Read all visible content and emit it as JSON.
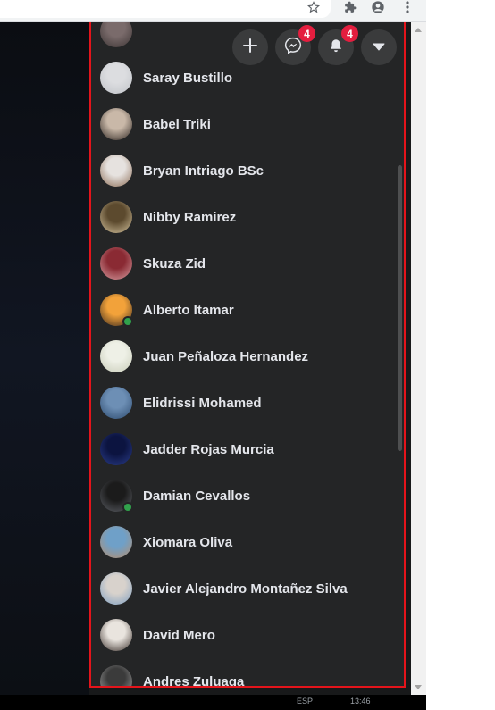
{
  "browser": {
    "icons": [
      "star-icon",
      "extensions-icon",
      "profile-icon",
      "menu-icon"
    ]
  },
  "header": {
    "buttons": [
      {
        "name": "create-button",
        "icon": "plus-icon"
      },
      {
        "name": "messenger-button",
        "icon": "messenger-icon",
        "badge": "4"
      },
      {
        "name": "notifications-button",
        "icon": "bell-icon",
        "badge": "4"
      },
      {
        "name": "account-button",
        "icon": "caret-down-icon"
      }
    ]
  },
  "contacts": [
    {
      "name": "",
      "online": false,
      "avatar_colors": [
        "#7a6b6b",
        "#3c3434"
      ]
    },
    {
      "name": "Saray Bustillo",
      "online": false,
      "avatar_colors": [
        "#dcdde0",
        "#bfc2c7"
      ]
    },
    {
      "name": "Babel Triki",
      "online": false,
      "avatar_colors": [
        "#c9b8a8",
        "#2c2420"
      ]
    },
    {
      "name": "Bryan Intriago BSc",
      "online": false,
      "avatar_colors": [
        "#e6e2df",
        "#8a6a52"
      ]
    },
    {
      "name": "Nibby Ramirez",
      "online": false,
      "avatar_colors": [
        "#5c4a2e",
        "#d6c5a0"
      ]
    },
    {
      "name": "Skuza Zid",
      "online": false,
      "avatar_colors": [
        "#8a2a33",
        "#d9a0a4"
      ]
    },
    {
      "name": "Alberto Itamar",
      "online": true,
      "avatar_colors": [
        "#f2a23a",
        "#3b2a1e"
      ]
    },
    {
      "name": "Juan Peñaloza Hernandez",
      "online": false,
      "avatar_colors": [
        "#eef0e6",
        "#c7cbb7"
      ]
    },
    {
      "name": "Elidrissi Mohamed",
      "online": false,
      "avatar_colors": [
        "#6d8fb5",
        "#2c4a6e"
      ]
    },
    {
      "name": "Jadder Rojas Murcia",
      "online": false,
      "avatar_colors": [
        "#0c1440",
        "#2a3d8a"
      ]
    },
    {
      "name": "Damian Cevallos",
      "online": true,
      "avatar_colors": [
        "#1b1b1b",
        "#5c5f66"
      ]
    },
    {
      "name": "Xiomara Oliva",
      "online": false,
      "avatar_colors": [
        "#6fa0c8",
        "#b78d6b"
      ]
    },
    {
      "name": "Javier Alejandro Montañez Silva",
      "online": false,
      "avatar_colors": [
        "#d8d2cc",
        "#7e9fc2"
      ]
    },
    {
      "name": "David Mero",
      "online": false,
      "avatar_colors": [
        "#e9e4de",
        "#3a2f2a"
      ]
    },
    {
      "name": "Andres Zuluaga",
      "online": false,
      "avatar_colors": [
        "#3b3b3b",
        "#a9a9a9"
      ]
    }
  ],
  "taskbar": {
    "left_text": "ESP",
    "time_text": "13:46"
  },
  "colors": {
    "panel_bg": "#242526",
    "highlight_border": "#e4141b",
    "badge": "#e41e3f",
    "online": "#31a24c"
  }
}
